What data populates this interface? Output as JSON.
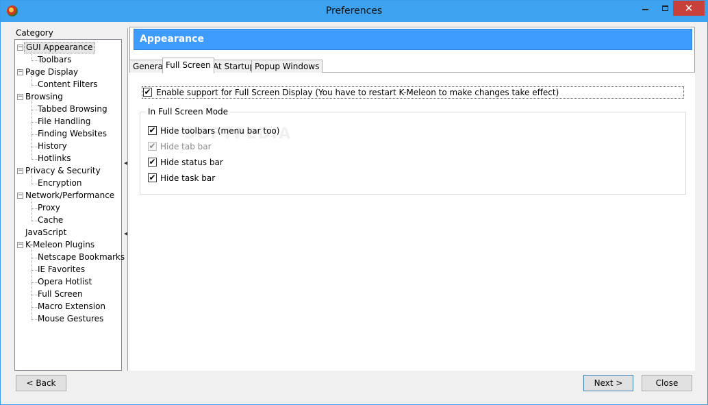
{
  "window": {
    "title": "Preferences"
  },
  "sidebar": {
    "label": "Category",
    "items": [
      {
        "label": "GUI Appearance",
        "level": 0,
        "expander": "⊟",
        "selected": true
      },
      {
        "label": "Toolbars",
        "level": 1
      },
      {
        "label": "Page Display",
        "level": 0,
        "expander": "⊟"
      },
      {
        "label": "Content Filters",
        "level": 1
      },
      {
        "label": "Browsing",
        "level": 0,
        "expander": "⊟"
      },
      {
        "label": "Tabbed Browsing",
        "level": 1
      },
      {
        "label": "File Handling",
        "level": 1
      },
      {
        "label": "Finding Websites",
        "level": 1
      },
      {
        "label": "History",
        "level": 1
      },
      {
        "label": "Hotlinks",
        "level": 1
      },
      {
        "label": "Privacy & Security",
        "level": 0,
        "expander": "⊟"
      },
      {
        "label": "Encryption",
        "level": 1
      },
      {
        "label": "Network/Performance",
        "level": 0,
        "expander": "⊟"
      },
      {
        "label": "Proxy",
        "level": 1
      },
      {
        "label": "Cache",
        "level": 1
      },
      {
        "label": "JavaScript",
        "level": 0
      },
      {
        "label": "K-Meleon Plugins",
        "level": 0,
        "expander": "⊟"
      },
      {
        "label": "Netscape Bookmarks",
        "level": 1
      },
      {
        "label": "IE Favorites",
        "level": 1
      },
      {
        "label": "Opera Hotlist",
        "level": 1
      },
      {
        "label": "Full Screen",
        "level": 1
      },
      {
        "label": "Macro Extension",
        "level": 1
      },
      {
        "label": "Mouse Gestures",
        "level": 1
      }
    ]
  },
  "main": {
    "header": "Appearance",
    "tabs": [
      {
        "label": "General",
        "active": false
      },
      {
        "label": "Full Screen",
        "active": true
      },
      {
        "label": "At Startup",
        "active": false
      },
      {
        "label": "Popup Windows",
        "active": false
      }
    ],
    "enable_option": {
      "label": "Enable support for Full Screen Display (You have to restart K-Meleon to make changes take effect)",
      "checked": true
    },
    "group": {
      "title": "In Full Screen Mode",
      "options": [
        {
          "label": "Hide toolbars (menu bar too)",
          "checked": true,
          "disabled": false
        },
        {
          "label": "Hide tab bar",
          "checked": true,
          "disabled": true
        },
        {
          "label": "Hide status bar",
          "checked": true,
          "disabled": false
        },
        {
          "label": "Hide task bar",
          "checked": true,
          "disabled": false
        }
      ]
    },
    "watermark": "SOFTPEDIA"
  },
  "footer": {
    "back_label": "< Back",
    "next_label": "Next >",
    "close_label": "Close"
  },
  "colors": {
    "titlebar": "#3da2ef",
    "header": "#3f9cff",
    "close_button": "#c7413a"
  }
}
